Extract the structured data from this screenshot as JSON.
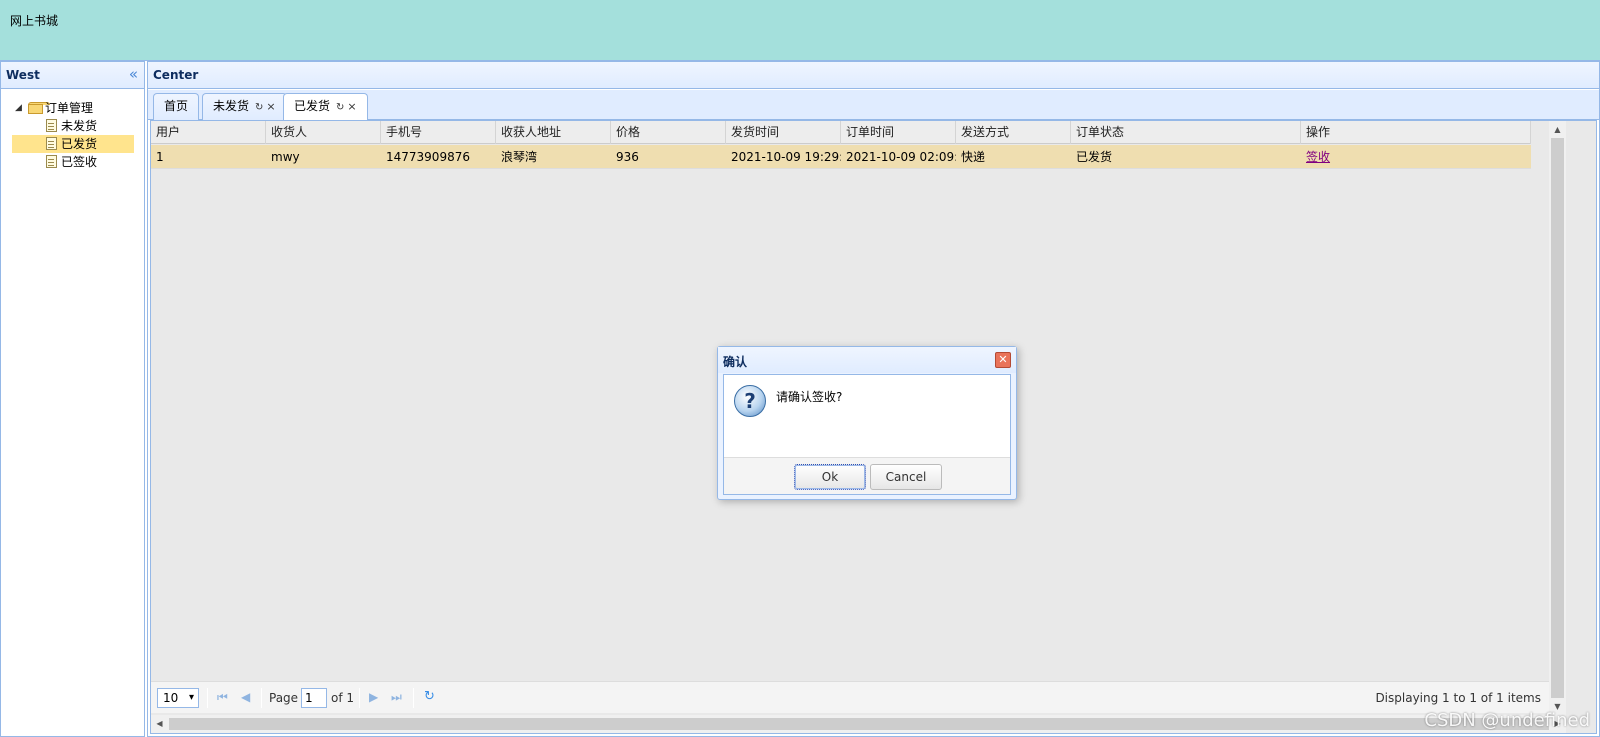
{
  "header": {
    "site_title": "网上书城"
  },
  "west": {
    "title": "West",
    "tree": {
      "root_label": "订单管理",
      "children": [
        {
          "label": "未发货",
          "selected": false
        },
        {
          "label": "已发货",
          "selected": true
        },
        {
          "label": "已签收",
          "selected": false
        }
      ]
    }
  },
  "center": {
    "title": "Center",
    "tabs": [
      {
        "label": "首页",
        "closable": false,
        "active": false
      },
      {
        "label": "未发货",
        "closable": true,
        "active": false
      },
      {
        "label": "已发货",
        "closable": true,
        "active": true
      }
    ],
    "grid": {
      "columns": [
        "用户",
        "收货人",
        "手机号",
        "收获人地址",
        "价格",
        "发货时间",
        "订单时间",
        "发送方式",
        "订单状态",
        "操作"
      ],
      "rows": [
        {
          "user": "1",
          "receiver": "mwy",
          "phone": "14773909876",
          "address": "浪琴湾",
          "price": "936",
          "ship_time": "2021-10-09 19:29:2",
          "order_time": "2021-10-09 02:09:5",
          "ship_method": "快递",
          "status": "已发货",
          "action": "签收"
        }
      ]
    },
    "pager": {
      "page_size": "10",
      "page_label": "Page",
      "page_value": "1",
      "of_label": "of 1",
      "display_text": "Displaying 1 to 1 of 1 items"
    }
  },
  "dialog": {
    "title": "确认",
    "message": "请确认签收?",
    "ok_label": "Ok",
    "cancel_label": "Cancel"
  },
  "watermark": "CSDN @undefined",
  "colors": {
    "header_bg": "#a4e0dc",
    "panel_border": "#95b8e7",
    "tree_selected": "#ffe48d",
    "row_selected": "#efdeb0",
    "link_visited": "#800080"
  }
}
